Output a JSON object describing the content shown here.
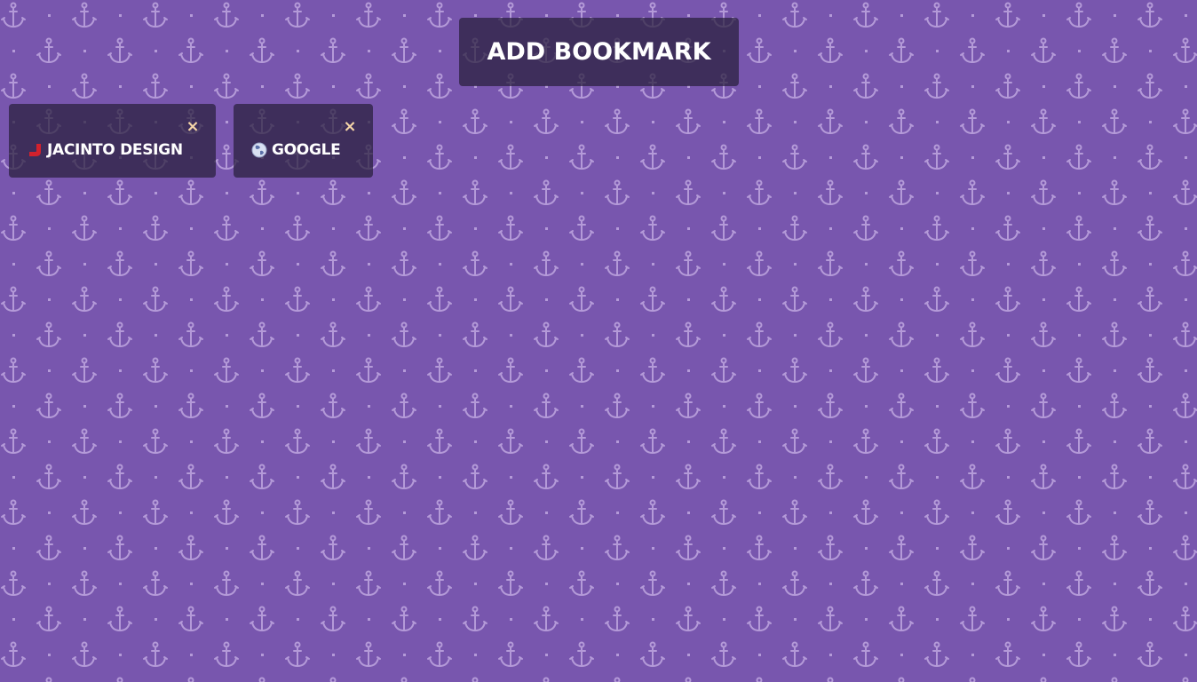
{
  "header": {
    "add_bookmark_label": "ADD BOOKMARK"
  },
  "bookmarks": [
    {
      "label": "JACINTO DESIGN",
      "favicon": "jacinto-j-icon",
      "favicon_color": "#d3212d"
    },
    {
      "label": "GOOGLE",
      "favicon": "globe-icon",
      "favicon_color": "#d9e0f2"
    }
  ],
  "close_glyph": "×",
  "theme": {
    "background": "#7856ae",
    "pattern": "anchor-icon",
    "pattern_color": "#b49ad8",
    "card_background": "#2d2342",
    "close_color": "#f6d6a8",
    "text_color": "#ffffff"
  }
}
